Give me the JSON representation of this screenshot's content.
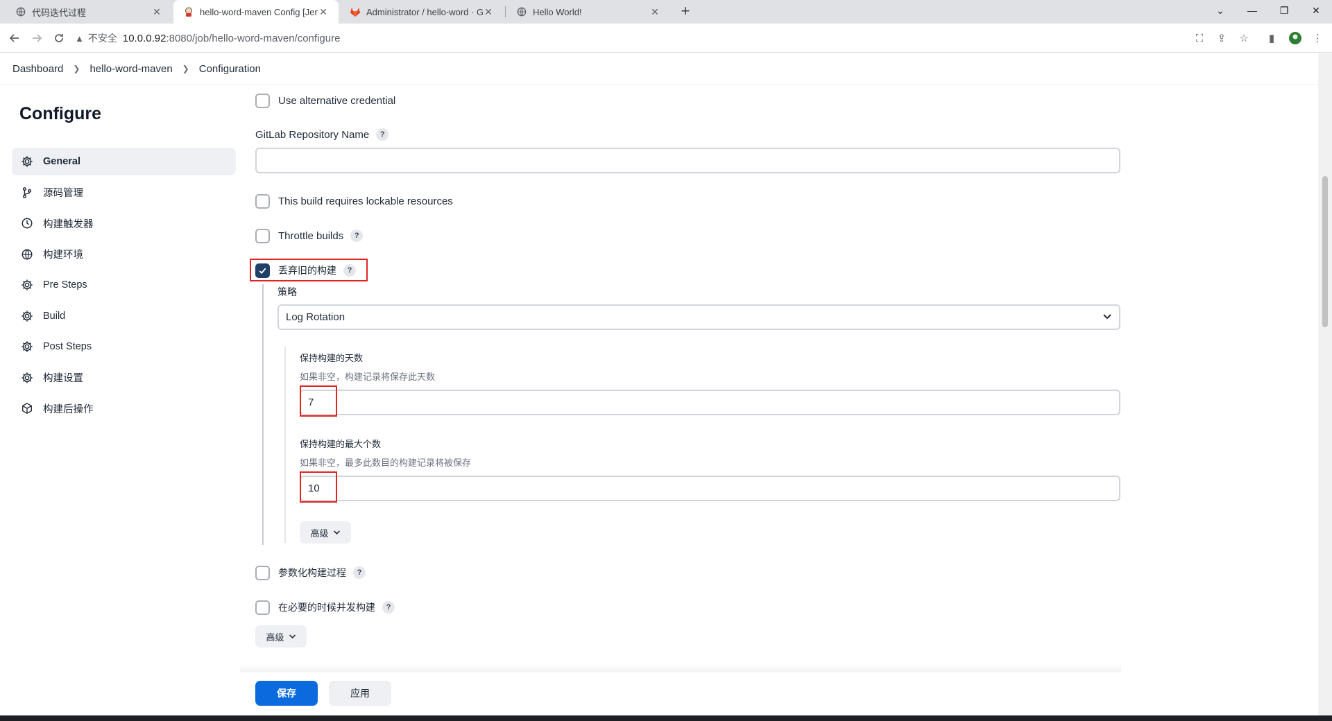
{
  "browser": {
    "tabs": [
      {
        "title": "代码迭代过程",
        "active": false
      },
      {
        "title": "hello-word-maven Config [Jen",
        "active": true
      },
      {
        "title": "Administrator / hello-word · G",
        "active": false
      },
      {
        "title": "Hello World!",
        "active": false
      }
    ],
    "address": {
      "security_label": "不安全",
      "host": "10.0.0.92",
      "path": ":8080/job/hello-word-maven/configure"
    }
  },
  "breadcrumb": [
    "Dashboard",
    "hello-word-maven",
    "Configuration"
  ],
  "sidebar": {
    "title": "Configure",
    "items": [
      {
        "label": "General",
        "icon": "gear-icon",
        "active": true
      },
      {
        "label": "源码管理",
        "icon": "git-branch-icon"
      },
      {
        "label": "构建触发器",
        "icon": "clock-icon"
      },
      {
        "label": "构建环境",
        "icon": "globe-icon"
      },
      {
        "label": "Pre Steps",
        "icon": "gear-icon"
      },
      {
        "label": "Build",
        "icon": "gear-icon"
      },
      {
        "label": "Post Steps",
        "icon": "gear-icon"
      },
      {
        "label": "构建设置",
        "icon": "gear-icon"
      },
      {
        "label": "构建后操作",
        "icon": "package-icon"
      }
    ]
  },
  "form": {
    "alt_credential": {
      "label": "Use alternative credential",
      "checked": false
    },
    "gitlab_repo": {
      "label": "GitLab Repository Name",
      "value": ""
    },
    "lockable": {
      "label": "This build requires lockable resources",
      "checked": false
    },
    "throttle": {
      "label": "Throttle builds",
      "checked": false
    },
    "discard_old": {
      "label": "丢弃旧的构建",
      "checked": true
    },
    "strategy": {
      "label": "策略",
      "selected": "Log Rotation"
    },
    "days_to_keep": {
      "label": "保持构建的天数",
      "hint": "如果非空，构建记录将保存此天数",
      "value": "7"
    },
    "max_builds": {
      "label": "保持构建的最大个数",
      "hint": "如果非空，最多此数目的构建记录将被保存",
      "value": "10"
    },
    "inner_advanced": "高级",
    "parameterized": {
      "label": "参数化构建过程",
      "checked": false
    },
    "concurrent": {
      "label": "在必要的时候并发构建",
      "checked": false
    },
    "outer_advanced": "高级",
    "help_mark": "?"
  },
  "buttons": {
    "save": "保存",
    "apply": "应用"
  },
  "colors": {
    "primary": "#0b6bde",
    "checkbox_checked": "#1f3f66",
    "highlight_box": "#e02424"
  }
}
